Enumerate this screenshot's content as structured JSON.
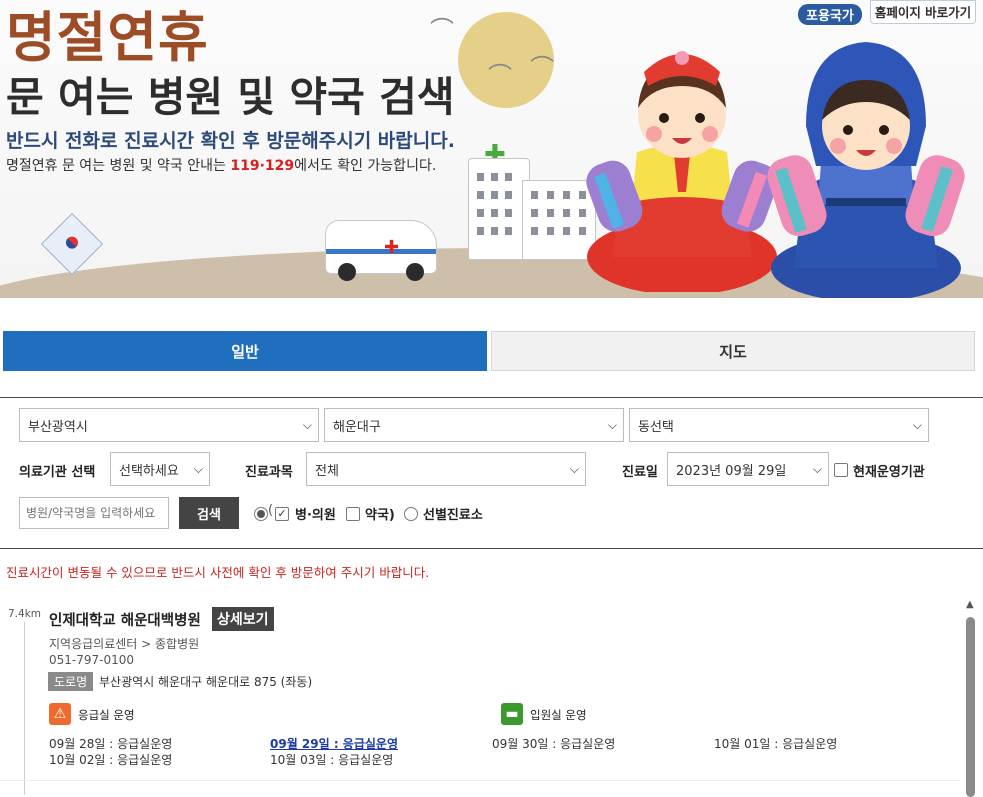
{
  "banner": {
    "title_main": "명절연휴",
    "title_sub": "문 여는 병원 및 약국 검색",
    "notice_bold": "반드시 전화로 진료시간 확인 후 방문해주시기 바랍니다.",
    "notice_line_pre": "명절연휴 문 여는 병원 및 약국 안내는 ",
    "notice_line_hl": "119·129",
    "notice_line_post": "에서도 확인 가능합니다.",
    "badge": "포용국가",
    "home_button": "홈페이지 바로가기"
  },
  "tabs": [
    {
      "label": "일반",
      "active": true
    },
    {
      "label": "지도",
      "active": false
    }
  ],
  "filters": {
    "city": "부산광역시",
    "district": "해운대구",
    "dong": "동선택",
    "facility_label": "의료기관 선택",
    "facility_value": "선택하세요",
    "dept_label": "진료과목",
    "dept_value": "전체",
    "date_label": "진료일",
    "date_value": "2023년 09월 29일",
    "operating_label": "현재운영기관",
    "search_placeholder": "병원/약국명을 입력하세요",
    "search_button": "검색",
    "type_hospital": "병·의원",
    "type_pharmacy": "약국)",
    "type_selective": "선별진료소"
  },
  "warning": "진료시간이 변동될 수 있으므로 반드시 사전에 확인 후 방문하여 주시기 바랍니다.",
  "results": [
    {
      "distance": "7.4km",
      "name": "인제대학교 해운대백병원",
      "detail_button": "상세보기",
      "category": "지역응급의료센터 > 종합병원",
      "phone": "051-797-0100",
      "road_tag": "도로명",
      "address": "부산광역시 해운대구 해운대로 875 (좌동)",
      "er_label": "응급실 운영",
      "ward_label": "입원실 운영",
      "schedule": [
        "09월 28일 : 응급실운영",
        "09월 29일 : 응급실운영",
        "09월 30일 : 응급실운영",
        "10월 01일 : 응급실운영",
        "10월 02일 : 응급실운영",
        "10월 03일 : 응급실운영"
      ]
    }
  ],
  "colors": {
    "tab_active": "#1f6fbe",
    "title_brown": "#9c4d26",
    "notice_blue": "#2d4b7a",
    "highlight_red": "#d61f1f",
    "warning_red": "#c8261f",
    "er_orange": "#ee6b2d",
    "ward_green": "#3a9a2e",
    "today_link": "#1a3aa8"
  },
  "icons": {
    "er": "siren-icon",
    "ward": "bed-icon",
    "dropdown": "chevron-down-icon"
  }
}
